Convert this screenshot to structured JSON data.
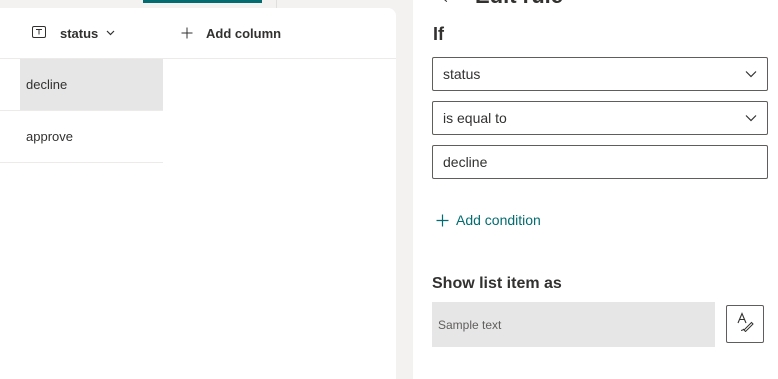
{
  "list": {
    "column_header": {
      "label": "status",
      "type_icon": "text-column-icon",
      "chevron_icon": "chevron-down-icon"
    },
    "add_column": {
      "label": "Add column",
      "icon": "plus-icon"
    },
    "rows": [
      {
        "status": "decline",
        "selected": true
      },
      {
        "status": "approve",
        "selected": false
      }
    ]
  },
  "rule_pane": {
    "title": "Edit rule",
    "back_icon": "arrow-left-icon",
    "if_label": "If",
    "column_select": {
      "value": "status"
    },
    "operator_select": {
      "value": "is equal to"
    },
    "value_input": {
      "value": "decline"
    },
    "add_condition": {
      "label": "Add condition",
      "icon": "plus-icon"
    },
    "show_label": "Show list item as",
    "preview": {
      "text": "Sample text"
    },
    "style_button": {
      "icon": "text-format-icon"
    }
  },
  "colors": {
    "accent": "#036c70",
    "selected_row": "#e6e6e6",
    "border": "#605e5c"
  }
}
